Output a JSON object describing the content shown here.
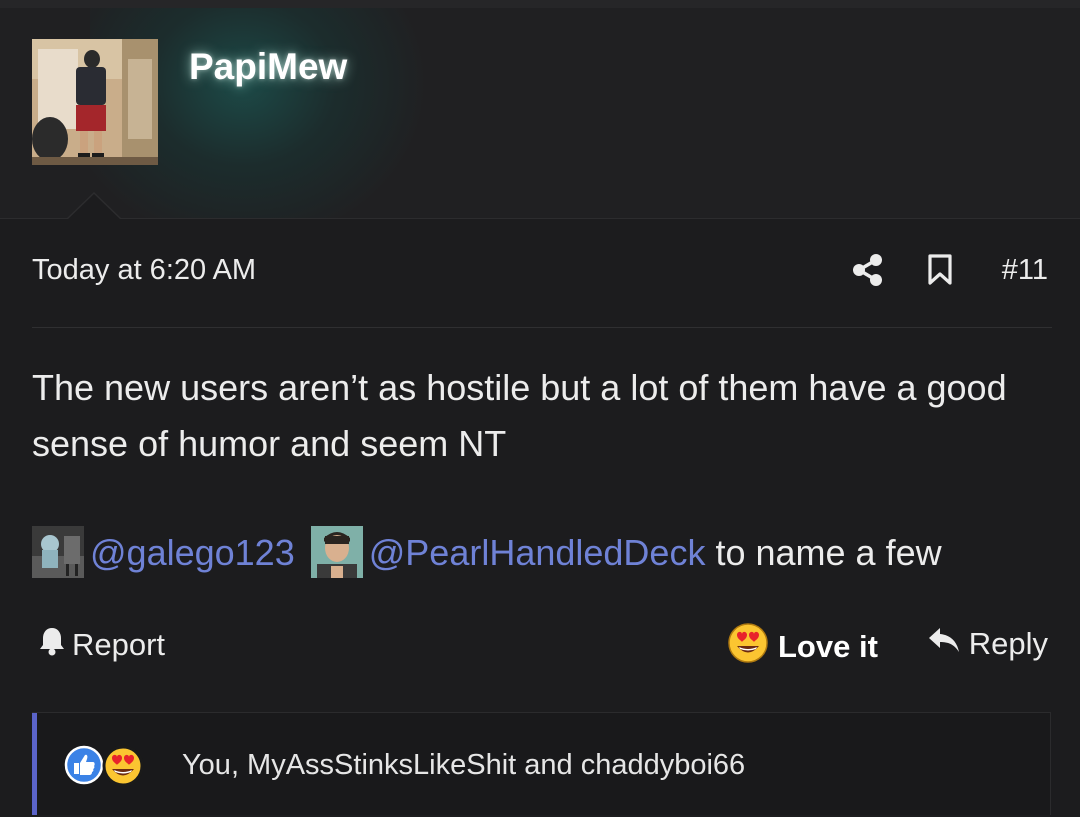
{
  "post": {
    "username": "PapiMew",
    "timestamp": "Today at 6:20 AM",
    "post_number": "#11",
    "body": "The new users aren’t as hostile but a lot of them have a good sense of humor and seem NT",
    "mentions": [
      {
        "handle": "@galego123"
      },
      {
        "handle": "@PearlHandledDeck"
      }
    ],
    "mentions_suffix": "to name a few"
  },
  "actions": {
    "report_label": "Report",
    "love_label": "Love it",
    "reply_label": "Reply"
  },
  "reactions": {
    "summary": "You, MyAssStinksLikeShit and chaddyboi66",
    "icons": [
      "like-icon",
      "heart-eyes-emoji-icon"
    ]
  },
  "colors": {
    "background": "#1c1c1e",
    "mention": "#6f82d6",
    "accent_bar": "#5b64c9",
    "like_blue": "#3b82e6"
  }
}
